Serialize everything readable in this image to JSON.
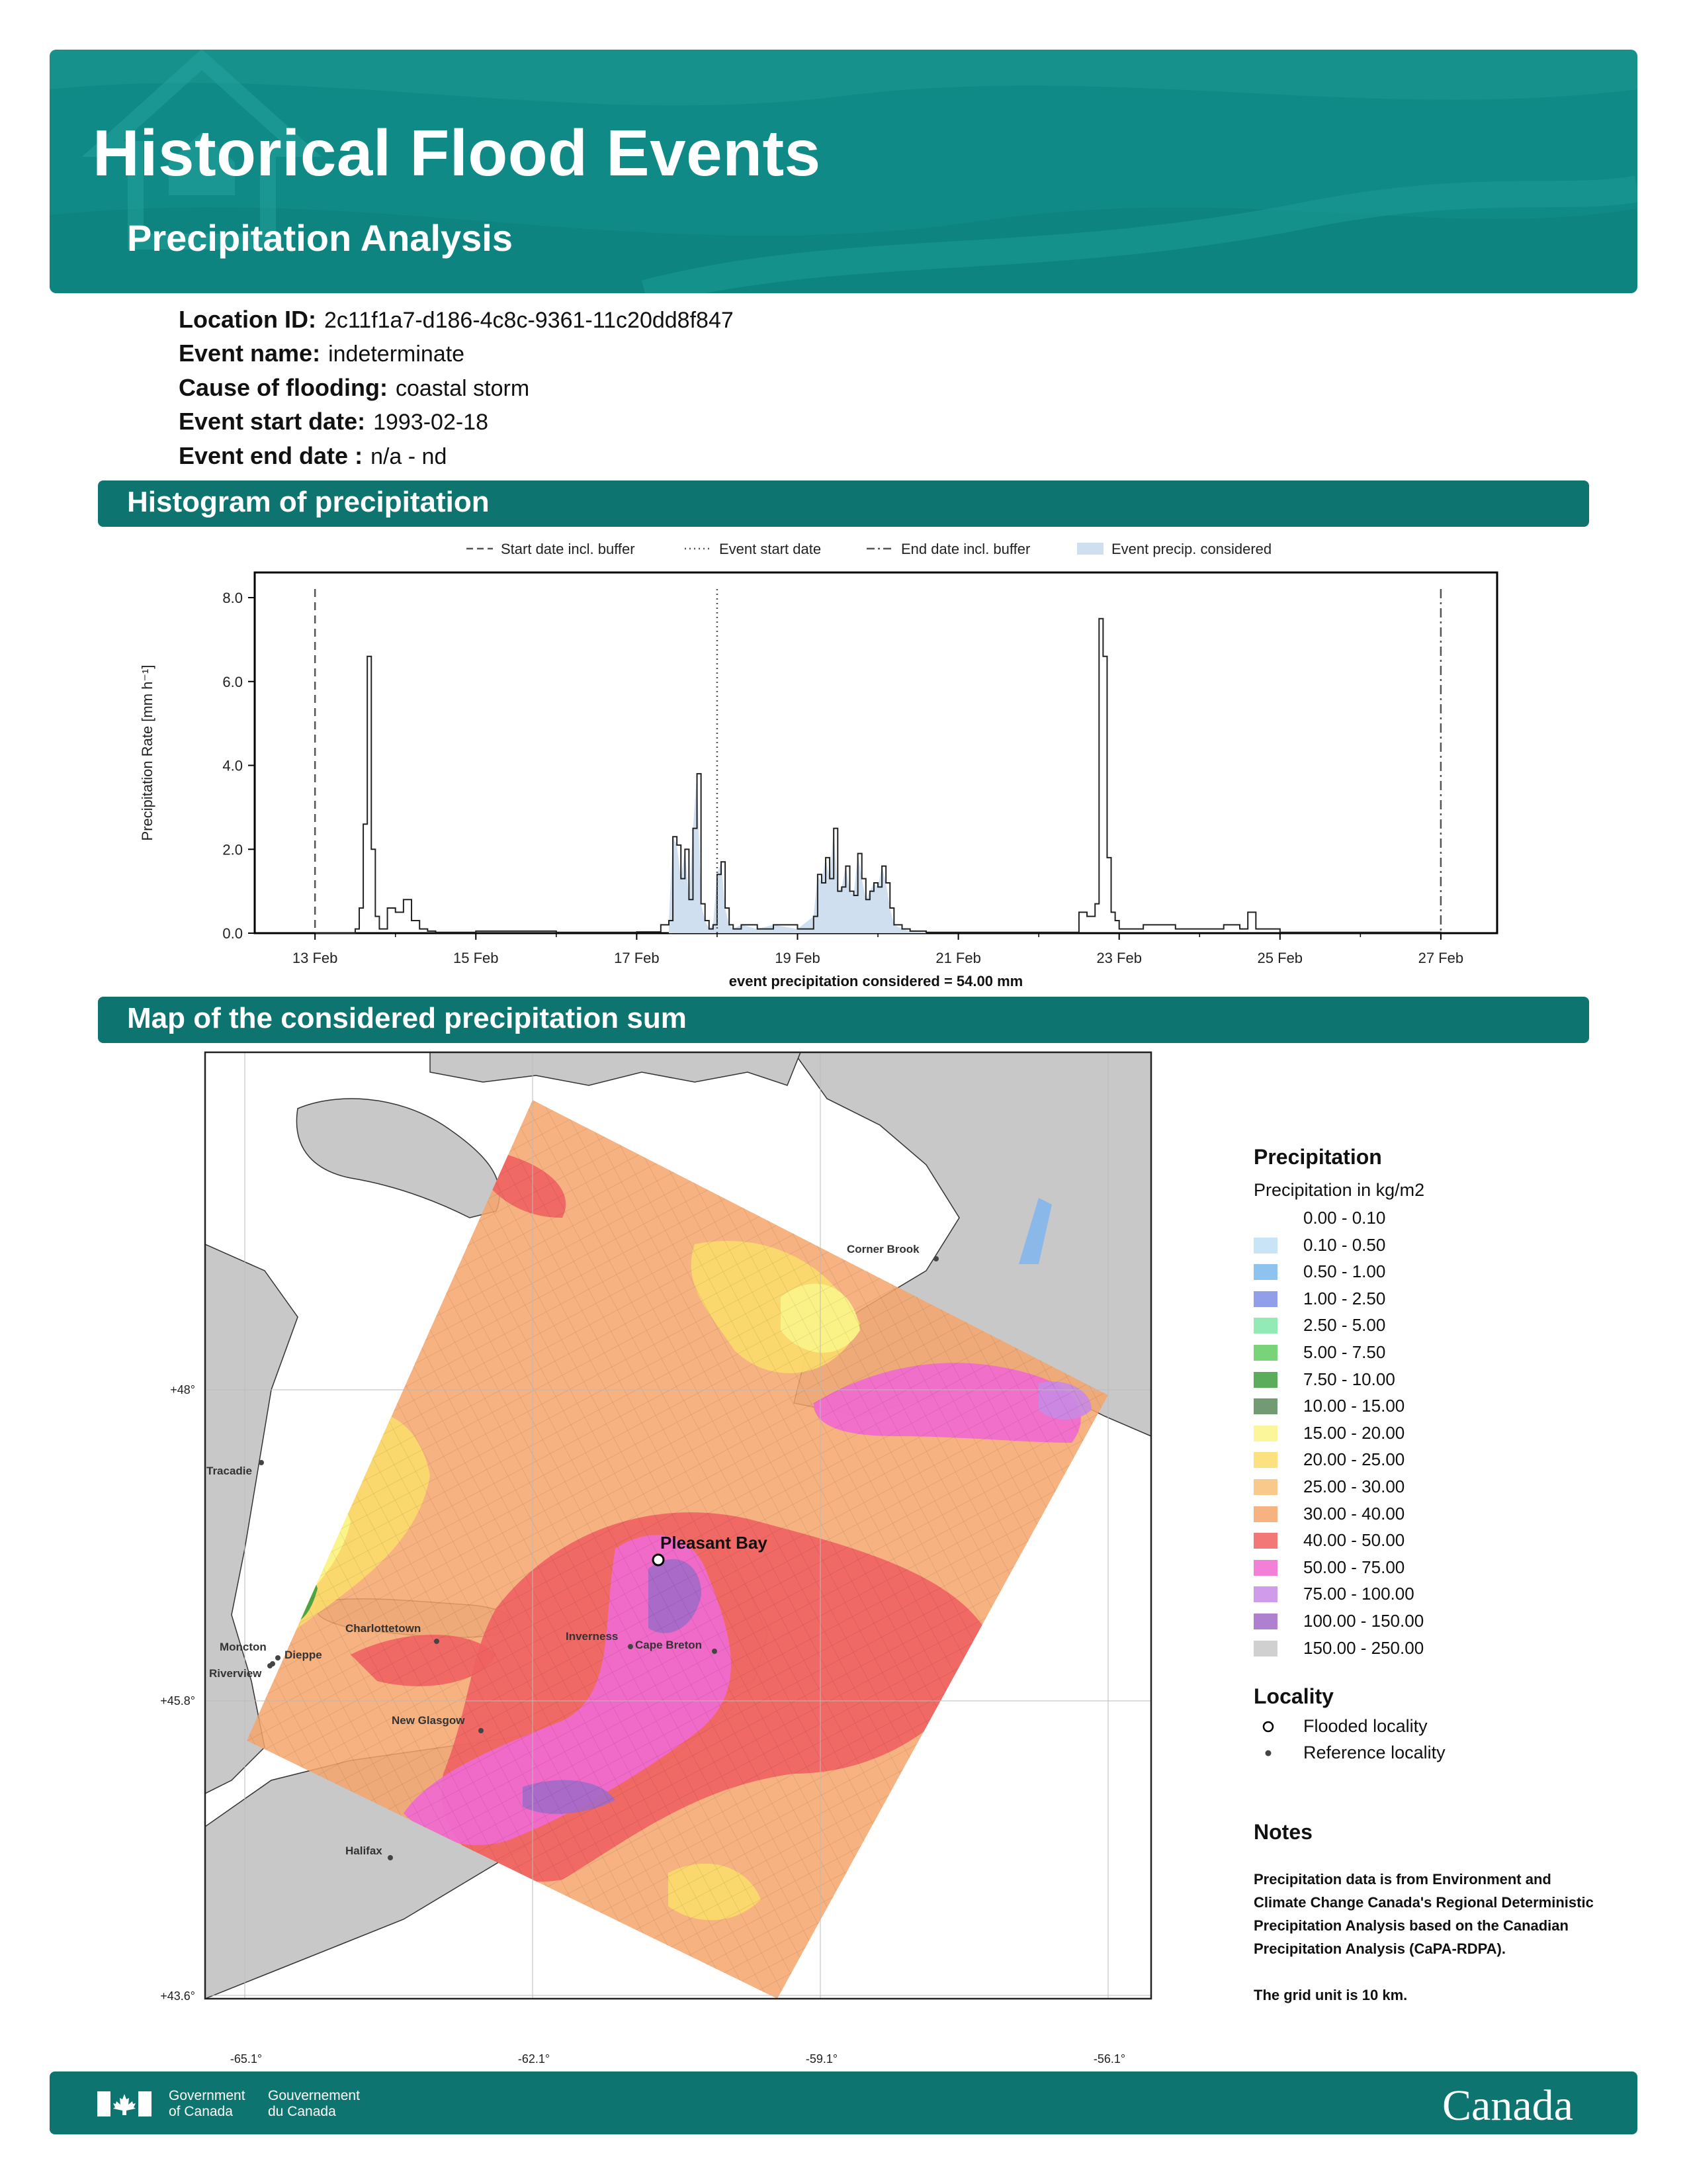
{
  "header": {
    "title": "Historical Flood Events",
    "subtitle": "Precipitation Analysis",
    "color": "#108a87"
  },
  "meta": [
    {
      "key": "Location ID:",
      "value": "2c11f1a7-d186-4c8c-9361-11c20dd8f847"
    },
    {
      "key": "Event name:",
      "value": "indeterminate"
    },
    {
      "key": "Cause of flooding:",
      "value": "coastal storm"
    },
    {
      "key": "Event start date:",
      "value": "1993-02-18"
    },
    {
      "key": "Event end date :",
      "value": "n/a - nd"
    }
  ],
  "sections": {
    "histogram": "Histogram of precipitation",
    "map": "Map of the considered precipitation sum"
  },
  "chart_data": {
    "type": "line",
    "ylabel": "Precipitation Rate [mm h⁻¹]",
    "ylim": [
      0,
      8
    ],
    "y_ticks": [
      "0.0",
      "2.0",
      "4.0",
      "6.0",
      "8.0"
    ],
    "x_ticks": [
      "13 Feb",
      "15 Feb",
      "17 Feb",
      "19 Feb",
      "21 Feb",
      "23 Feb",
      "25 Feb",
      "27 Feb"
    ],
    "xlim_days": [
      -0.75,
      14.7
    ],
    "footer": "event precipitation considered = 54.00 mm",
    "legend": [
      "Start date incl. buffer",
      "Event start date",
      "End date incl. buffer",
      "Event precip. considered"
    ],
    "markers": {
      "start_buffer": 0,
      "event_start": 5,
      "end_buffer": 14
    },
    "fill_color": "#d0dff0",
    "series": [
      {
        "x": [
          0,
          0.5,
          0.55,
          0.6,
          0.65,
          0.7,
          0.75,
          0.8,
          0.9,
          1.0,
          1.1,
          1.2,
          1.3,
          1.4,
          1.5,
          1.6,
          2.0,
          3.0,
          4.0,
          4.3,
          4.4,
          4.45,
          4.5,
          4.55,
          4.6,
          4.65,
          4.7,
          4.75,
          4.8,
          4.85,
          4.9,
          4.95,
          5.0,
          5.05,
          5.1,
          5.15,
          5.2,
          5.3,
          5.5,
          5.7,
          6.0,
          6.2,
          6.25,
          6.3,
          6.35,
          6.4,
          6.45,
          6.5,
          6.55,
          6.6,
          6.65,
          6.7,
          6.75,
          6.8,
          6.85,
          6.9,
          6.95,
          7.0,
          7.05,
          7.1,
          7.15,
          7.2,
          7.3,
          7.4,
          7.6,
          8.0,
          9.0,
          9.5,
          9.6,
          9.7,
          9.75,
          9.8,
          9.85,
          9.9,
          9.95,
          10.0,
          10.1,
          10.3,
          10.7,
          11.0,
          11.3,
          11.5,
          11.6,
          11.7,
          12.0,
          13.0,
          14.0
        ],
        "y": [
          0,
          0.1,
          0.6,
          2.6,
          6.6,
          2.0,
          0.4,
          0.1,
          0.6,
          0.5,
          0.8,
          0.3,
          0.1,
          0.05,
          0.02,
          0.02,
          0.05,
          0.02,
          0.03,
          0.2,
          0.3,
          2.3,
          2.1,
          1.3,
          2.0,
          0.8,
          2.5,
          3.8,
          0.7,
          0.3,
          0.1,
          0.2,
          1.4,
          1.7,
          0.6,
          0.2,
          0.1,
          0.2,
          0.1,
          0.2,
          0.1,
          0.4,
          1.4,
          1.2,
          1.8,
          1.3,
          2.5,
          1.0,
          1.1,
          1.6,
          1.0,
          0.9,
          1.9,
          1.3,
          0.8,
          1.0,
          1.2,
          1.1,
          1.6,
          1.2,
          0.6,
          0.2,
          0.1,
          0.05,
          0.02,
          0.02,
          0.02,
          0.5,
          0.4,
          0.7,
          7.5,
          6.6,
          1.8,
          0.5,
          0.3,
          0.1,
          0.1,
          0.2,
          0.1,
          0.1,
          0.2,
          0.1,
          0.5,
          0.1,
          0.02,
          0.02,
          0
        ]
      }
    ]
  },
  "map": {
    "lon_ticks": [
      "-65.1°",
      "-62.1°",
      "-59.1°",
      "-56.1°"
    ],
    "lat_ticks": [
      "+48°",
      "+45.8°",
      "+43.6°"
    ],
    "flooded_locality": "Pleasant Bay",
    "reference_localities": [
      "Corner Brook",
      "Tracadie",
      "Moncton",
      "Dieppe",
      "Riverview",
      "Charlottetown",
      "Inverness",
      "Cape Breton",
      "New Glasgow",
      "Halifax"
    ]
  },
  "legend": {
    "title": "Precipitation",
    "subtitle": "Precipitation in kg/m2",
    "items": [
      {
        "label": "0.00 - 0.10",
        "color": "#ffffff"
      },
      {
        "label": "0.10 - 0.50",
        "color": "#bfdff5"
      },
      {
        "label": "0.50 - 1.00",
        "color": "#7ab8ec"
      },
      {
        "label": "1.00 - 2.50",
        "color": "#7e8de6"
      },
      {
        "label": "2.50 - 5.00",
        "color": "#7fe6a8"
      },
      {
        "label": "5.00 - 7.50",
        "color": "#62cc62"
      },
      {
        "label": "7.50 - 10.00",
        "color": "#3e9e3e"
      },
      {
        "label": "10.00 - 15.00",
        "color": "#5a8a5a"
      },
      {
        "label": "15.00 - 20.00",
        "color": "#fbf58a"
      },
      {
        "label": "20.00 - 25.00",
        "color": "#fbdc6a"
      },
      {
        "label": "25.00 - 30.00",
        "color": "#f8c078"
      },
      {
        "label": "30.00 - 40.00",
        "color": "#f5a46a"
      },
      {
        "label": "40.00 - 50.00",
        "color": "#f06060"
      },
      {
        "label": "50.00 - 75.00",
        "color": "#f06ad0"
      },
      {
        "label": "75.00 - 100.00",
        "color": "#c88ae4"
      },
      {
        "label": "100.00 - 150.00",
        "color": "#a26ac8"
      },
      {
        "label": "150.00 - 250.00",
        "color": "#c8c8c8"
      }
    ]
  },
  "locality": {
    "title": "Locality",
    "flooded": "Flooded locality",
    "reference": "Reference locality"
  },
  "notes": {
    "title": "Notes",
    "line1": "Precipitation data is from Environment and Climate Change Canada's Regional Deterministic Precipitation Analysis based on the Canadian Precipitation Analysis (CaPA-RDPA).",
    "line2": "The grid unit is 10 km."
  },
  "footer": {
    "gov_en_1": "Government",
    "gov_en_2": "of Canada",
    "gov_fr_1": "Gouvernement",
    "gov_fr_2": "du Canada",
    "wordmark": "Canada"
  }
}
